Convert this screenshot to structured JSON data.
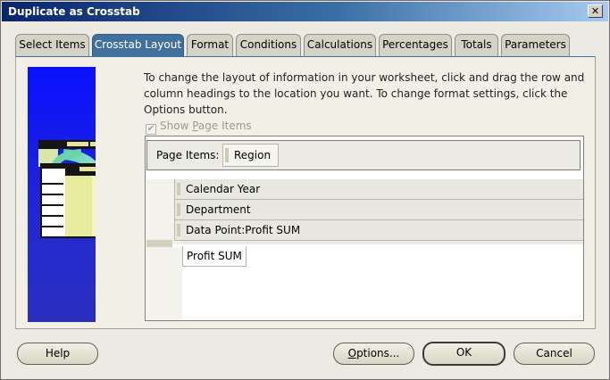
{
  "window": {
    "title": "Duplicate as Crosstab",
    "close_glyph": "✕"
  },
  "tabs": [
    {
      "label": "Select Items",
      "active": false
    },
    {
      "label": "Crosstab Layout",
      "active": true
    },
    {
      "label": "Format",
      "active": false
    },
    {
      "label": "Conditions",
      "active": false
    },
    {
      "label": "Calculations",
      "active": false
    },
    {
      "label": "Percentages",
      "active": false
    },
    {
      "label": "Totals",
      "active": false
    },
    {
      "label": "Parameters",
      "active": false
    }
  ],
  "crosstab_layout": {
    "instructions": "To change the layout of information in your worksheet, click and drag the row and column headings to the location you want.  To change format settings, click the Options button.",
    "show_page_items": {
      "label_prefix": "Show ",
      "label_mnemonic": "P",
      "label_suffix": "age Items",
      "checked": true,
      "enabled": false
    },
    "page_items_label": "Page Items:",
    "page_items": [
      "Region"
    ],
    "row_items": [
      "Calendar Year",
      "Department",
      "Data Point:Profit SUM"
    ],
    "data_items": [
      "Profit SUM"
    ]
  },
  "buttons": {
    "help": "Help",
    "options_mnemonic": "O",
    "options_rest": "ptions...",
    "ok": "OK",
    "cancel": "Cancel"
  },
  "colors": {
    "active_tab": "#42709d",
    "art_background": "#1a1fe0",
    "title_bar_start": "#0a246a"
  }
}
